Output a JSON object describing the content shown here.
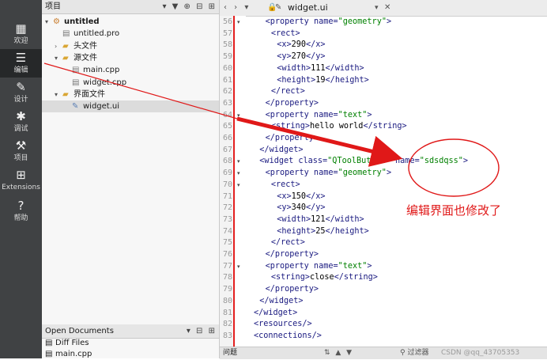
{
  "modebar": {
    "items": [
      {
        "label": "欢迎",
        "icon": "grid-icon",
        "glyph": "▦"
      },
      {
        "label": "编辑",
        "icon": "edit-icon",
        "glyph": "☰"
      },
      {
        "label": "设计",
        "icon": "design-icon",
        "glyph": "✎"
      },
      {
        "label": "调试",
        "icon": "debug-icon",
        "glyph": "✱"
      },
      {
        "label": "项目",
        "icon": "wrench-icon",
        "glyph": "⚒"
      },
      {
        "label": "Extensions",
        "icon": "extensions-icon",
        "glyph": "⊞"
      },
      {
        "label": "帮助",
        "icon": "help-icon",
        "glyph": "?"
      }
    ]
  },
  "project": {
    "title": "项目",
    "tools": "▾ ▼ ⊕ ⊟ ⊞",
    "tree": [
      {
        "label": "untitled",
        "bold": true,
        "arrow": "▾",
        "icon": "project-icon"
      },
      {
        "label": "untitled.pro",
        "icon": "pro-file-icon"
      },
      {
        "label": "头文件",
        "arrow": "›",
        "icon": "folder-icon"
      },
      {
        "label": "源文件",
        "arrow": "▾",
        "icon": "folder-icon"
      },
      {
        "label": "main.cpp",
        "icon": "cpp-file-icon"
      },
      {
        "label": "widget.cpp",
        "icon": "cpp-file-icon"
      },
      {
        "label": "界面文件",
        "arrow": "▾",
        "icon": "folder-icon"
      },
      {
        "label": "widget.ui",
        "icon": "ui-file-icon"
      }
    ]
  },
  "open_documents": {
    "title": "Open Documents",
    "tools": "▾ ⊟ ⊞",
    "items": [
      "Diff Files",
      "main.cpp"
    ]
  },
  "editor": {
    "nav": "‹ › ▾",
    "lock": "🔒",
    "file_name": "widget.ui",
    "dropdown": "▾",
    "close": "✕",
    "lines": [
      {
        "n": "56",
        "fold": "▾",
        "indent": 2,
        "parts": [
          [
            "t",
            "<"
          ],
          [
            "t",
            "property"
          ],
          [
            "a",
            " name="
          ],
          [
            "v",
            "\"geometry\""
          ],
          [
            "t",
            ">"
          ]
        ]
      },
      {
        "n": "57",
        "fold": "",
        "indent": 3,
        "parts": [
          [
            "t",
            "<rect>"
          ]
        ]
      },
      {
        "n": "58",
        "fold": "",
        "indent": 4,
        "parts": [
          [
            "t",
            "<x>"
          ],
          [
            "x",
            "290"
          ],
          [
            "t",
            "</x>"
          ]
        ]
      },
      {
        "n": "59",
        "fold": "",
        "indent": 4,
        "parts": [
          [
            "t",
            "<y>"
          ],
          [
            "x",
            "270"
          ],
          [
            "t",
            "</y>"
          ]
        ]
      },
      {
        "n": "60",
        "fold": "",
        "indent": 4,
        "parts": [
          [
            "t",
            "<width>"
          ],
          [
            "x",
            "111"
          ],
          [
            "t",
            "</width>"
          ]
        ]
      },
      {
        "n": "61",
        "fold": "",
        "indent": 4,
        "parts": [
          [
            "t",
            "<height>"
          ],
          [
            "x",
            "19"
          ],
          [
            "t",
            "</height>"
          ]
        ]
      },
      {
        "n": "62",
        "fold": "",
        "indent": 3,
        "parts": [
          [
            "t",
            "</rect>"
          ]
        ]
      },
      {
        "n": "63",
        "fold": "",
        "indent": 2,
        "parts": [
          [
            "t",
            "</property>"
          ]
        ]
      },
      {
        "n": "64",
        "fold": "▾",
        "indent": 2,
        "parts": [
          [
            "t",
            "<property"
          ],
          [
            "a",
            " name="
          ],
          [
            "v",
            "\"text\""
          ],
          [
            "t",
            ">"
          ]
        ]
      },
      {
        "n": "65",
        "fold": "",
        "indent": 3,
        "parts": [
          [
            "t",
            "<string>"
          ],
          [
            "x",
            "hello world"
          ],
          [
            "t",
            "</string>"
          ]
        ]
      },
      {
        "n": "66",
        "fold": "",
        "indent": 2,
        "parts": [
          [
            "t",
            "</property>"
          ]
        ]
      },
      {
        "n": "67",
        "fold": "",
        "indent": 1,
        "parts": [
          [
            "t",
            "</widget>"
          ]
        ]
      },
      {
        "n": "68",
        "fold": "▾",
        "indent": 1,
        "parts": [
          [
            "t",
            "<widget"
          ],
          [
            "a",
            " class="
          ],
          [
            "v",
            "\"QToolButton\""
          ],
          [
            "a",
            " name="
          ],
          [
            "v",
            "\"sdsdqss\""
          ],
          [
            "t",
            ">"
          ]
        ]
      },
      {
        "n": "69",
        "fold": "▾",
        "indent": 2,
        "parts": [
          [
            "t",
            "<property"
          ],
          [
            "a",
            " name="
          ],
          [
            "v",
            "\"geometry\""
          ],
          [
            "t",
            ">"
          ]
        ]
      },
      {
        "n": "70",
        "fold": "▾",
        "indent": 3,
        "parts": [
          [
            "t",
            "<rect>"
          ]
        ]
      },
      {
        "n": "71",
        "fold": "",
        "indent": 4,
        "parts": [
          [
            "t",
            "<x>"
          ],
          [
            "x",
            "150"
          ],
          [
            "t",
            "</x>"
          ]
        ]
      },
      {
        "n": "72",
        "fold": "",
        "indent": 4,
        "parts": [
          [
            "t",
            "<y>"
          ],
          [
            "x",
            "340"
          ],
          [
            "t",
            "</y>"
          ]
        ]
      },
      {
        "n": "73",
        "fold": "",
        "indent": 4,
        "parts": [
          [
            "t",
            "<width>"
          ],
          [
            "x",
            "121"
          ],
          [
            "t",
            "</width>"
          ]
        ]
      },
      {
        "n": "74",
        "fold": "",
        "indent": 4,
        "parts": [
          [
            "t",
            "<height>"
          ],
          [
            "x",
            "25"
          ],
          [
            "t",
            "</height>"
          ]
        ]
      },
      {
        "n": "75",
        "fold": "",
        "indent": 3,
        "parts": [
          [
            "t",
            "</rect>"
          ]
        ]
      },
      {
        "n": "76",
        "fold": "",
        "indent": 2,
        "parts": [
          [
            "t",
            "</property>"
          ]
        ]
      },
      {
        "n": "77",
        "fold": "▾",
        "indent": 2,
        "parts": [
          [
            "t",
            "<property"
          ],
          [
            "a",
            " name="
          ],
          [
            "v",
            "\"text\""
          ],
          [
            "t",
            ">"
          ]
        ]
      },
      {
        "n": "78",
        "fold": "",
        "indent": 3,
        "parts": [
          [
            "t",
            "<string>"
          ],
          [
            "x",
            "close"
          ],
          [
            "t",
            "</string>"
          ]
        ]
      },
      {
        "n": "79",
        "fold": "",
        "indent": 2,
        "parts": [
          [
            "t",
            "</property>"
          ]
        ]
      },
      {
        "n": "80",
        "fold": "",
        "indent": 1,
        "parts": [
          [
            "t",
            "</widget>"
          ]
        ]
      },
      {
        "n": "81",
        "fold": "",
        "indent": 0,
        "parts": [
          [
            "t",
            "</widget>"
          ]
        ]
      },
      {
        "n": "82",
        "fold": "",
        "indent": 0,
        "parts": [
          [
            "t",
            "<resources/>"
          ]
        ]
      },
      {
        "n": "83",
        "fold": "",
        "indent": 0,
        "parts": [
          [
            "t",
            "<connections/>"
          ]
        ]
      }
    ]
  },
  "annotation": {
    "text": "编辑界面也修改了",
    "color": "#e01818"
  },
  "status_bar": {
    "label": "问题",
    "tools": "⇅ ▲ ▼",
    "filter_placeholder": "⚲ 过滤器",
    "watermark": "CSDN @qq_43705353"
  },
  "colors": {
    "modebar_bg": "#404244",
    "modebar_active": "#262829",
    "tag": "#1a1a80",
    "string_value": "#008000",
    "annotation_red": "#e01818"
  }
}
